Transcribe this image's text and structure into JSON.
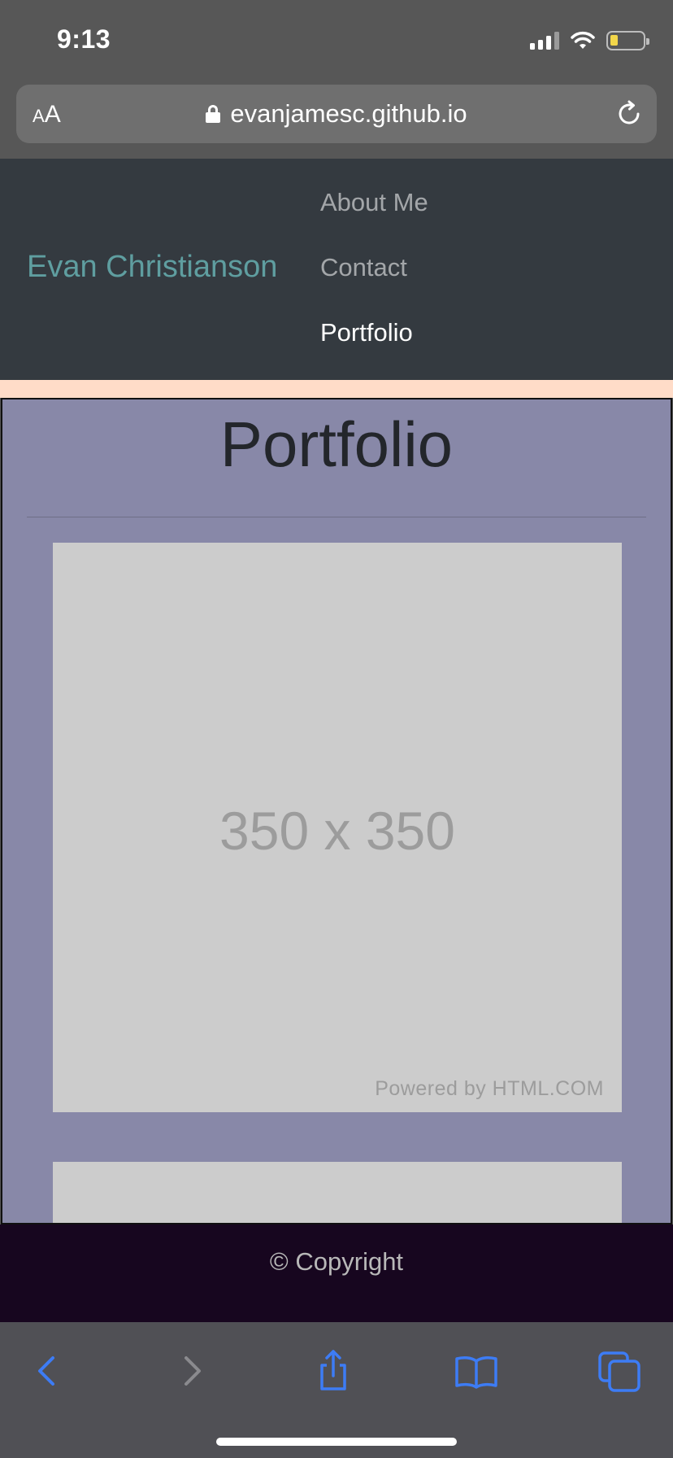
{
  "status_bar": {
    "time": "9:13"
  },
  "browser": {
    "text_size_small": "A",
    "text_size_large": "A",
    "url": "evanjamesc.github.io"
  },
  "navbar": {
    "brand": "Evan Christianson",
    "links": [
      {
        "label": "About Me",
        "active": false
      },
      {
        "label": "Contact",
        "active": false
      },
      {
        "label": "Portfolio",
        "active": true
      }
    ]
  },
  "main": {
    "title": "Portfolio",
    "placeholder": {
      "dimensions": "350 x 350",
      "powered_by": "Powered by HTML.COM"
    }
  },
  "footer": {
    "copyright": "© Copyright"
  },
  "colors": {
    "brand": "#5f9ea0",
    "navbar_bg": "#343a40",
    "main_bg": "#8888a8",
    "footer_bg": "#17061f",
    "accent_strip": "#ffdcc8",
    "toolbar_icon": "#3d7cf5"
  },
  "toolbar": {
    "icons": [
      "back-icon",
      "forward-icon",
      "share-icon",
      "bookmarks-icon",
      "tabs-icon"
    ]
  }
}
